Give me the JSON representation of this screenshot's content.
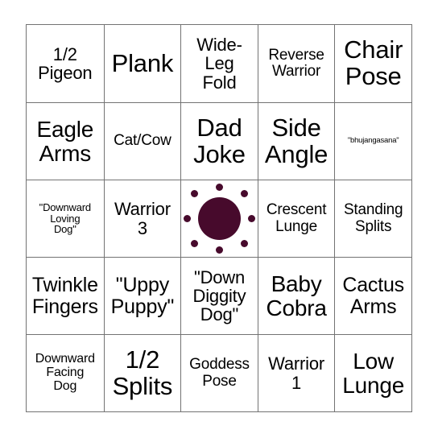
{
  "card": {
    "type": "bingo-card",
    "grid_size": "5x5",
    "accent_color": "#470A2C",
    "border_color": "#737373",
    "text_color": "#000000",
    "background_color": "#FFFFFF",
    "rows": [
      [
        {
          "label": "1/2\nPigeon",
          "size": "md",
          "kind": "text"
        },
        {
          "label": "Plank",
          "size": "xxl",
          "kind": "text"
        },
        {
          "label": "Wide-\nLeg\nFold",
          "size": "md",
          "kind": "text"
        },
        {
          "label": "Reverse\nWarrior",
          "size": "sm",
          "kind": "text"
        },
        {
          "label": "Chair\nPose",
          "size": "xxl",
          "kind": "text"
        }
      ],
      [
        {
          "label": "Eagle\nArms",
          "size": "xl",
          "kind": "text"
        },
        {
          "label": "Cat/Cow",
          "size": "sm",
          "kind": "text"
        },
        {
          "label": "Dad\nJoke",
          "size": "xxl",
          "kind": "text"
        },
        {
          "label": "Side\nAngle",
          "size": "xxl",
          "kind": "text"
        },
        {
          "label": "\"bhujangasana\"",
          "size": "tiny",
          "kind": "text"
        }
      ],
      [
        {
          "label": "\"Downward\nLoving\nDog\"",
          "size": "xxs",
          "kind": "text"
        },
        {
          "label": "Warrior\n3",
          "size": "md",
          "kind": "text"
        },
        {
          "label": "",
          "size": "md",
          "kind": "free-space"
        },
        {
          "label": "Crescent\nLunge",
          "size": "sm",
          "kind": "text"
        },
        {
          "label": "Standing\nSplits",
          "size": "sm",
          "kind": "text"
        }
      ],
      [
        {
          "label": "Twinkle\nFingers",
          "size": "lg",
          "kind": "text"
        },
        {
          "label": "\"Uppy\nPuppy\"",
          "size": "lg",
          "kind": "text"
        },
        {
          "label": "\"Down\nDiggity\nDog\"",
          "size": "md",
          "kind": "text"
        },
        {
          "label": "Baby\nCobra",
          "size": "xl",
          "kind": "text"
        },
        {
          "label": "Cactus\nArms",
          "size": "lg",
          "kind": "text"
        }
      ],
      [
        {
          "label": "Downward\nFacing\nDog",
          "size": "xs",
          "kind": "text"
        },
        {
          "label": "1/2\nSplits",
          "size": "xxl",
          "kind": "text"
        },
        {
          "label": "Goddess\nPose",
          "size": "sm",
          "kind": "text"
        },
        {
          "label": "Warrior\n1",
          "size": "md",
          "kind": "text"
        },
        {
          "label": "Low\nLunge",
          "size": "xl",
          "kind": "text"
        }
      ]
    ],
    "free_space": {
      "icon": "sun-icon",
      "ray_count": 8,
      "color": "#470A2C"
    }
  }
}
